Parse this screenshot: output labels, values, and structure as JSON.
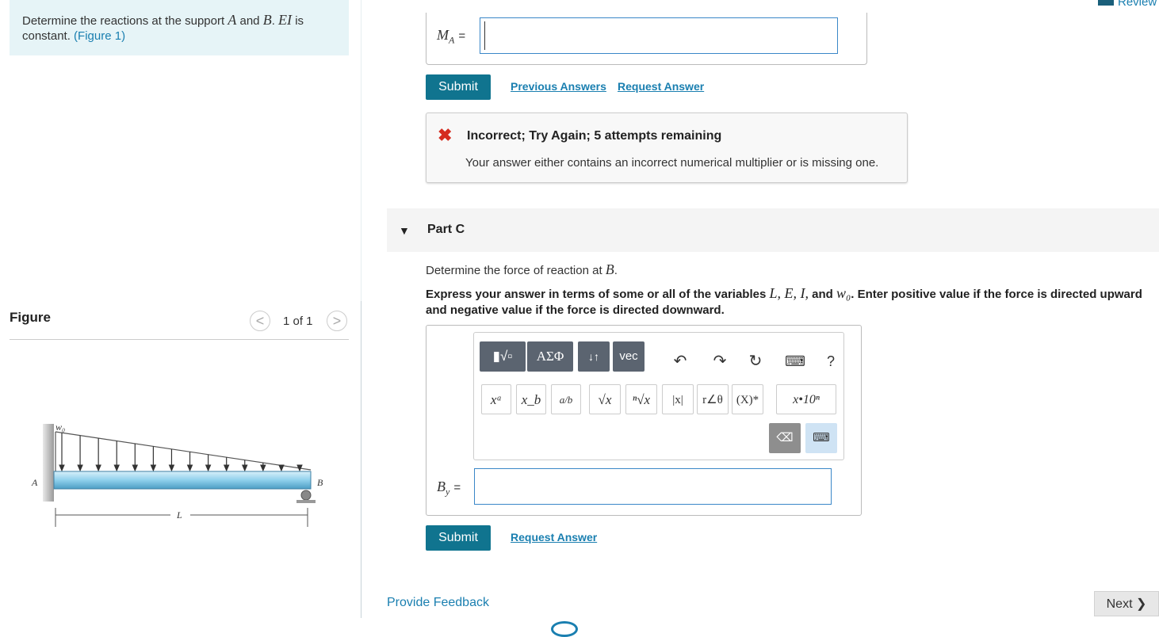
{
  "header": {
    "review_label": "Review"
  },
  "problem": {
    "text_prefix": "Determine the reactions at the support ",
    "A": "A",
    "and": " and ",
    "B": "B",
    "dot": ". ",
    "EI": "EI",
    "text_suffix": " is constant. ",
    "figure_link": "(Figure 1)"
  },
  "figure": {
    "title": "Figure",
    "counter": "1 of 1",
    "prev_glyph": "<",
    "next_glyph": ">",
    "labels": {
      "w0": "w₀",
      "A": "A",
      "B": "B",
      "L": "L"
    }
  },
  "part_b": {
    "label": "M",
    "label_sub": "A",
    "equals": "=",
    "input_value": "",
    "submit_label": "Submit",
    "previous_answers_label": "Previous Answers",
    "request_answer_label": "Request Answer",
    "feedback": {
      "title": "Incorrect; Try Again; 5 attempts remaining",
      "message": "Your answer either contains an incorrect numerical multiplier or is missing one."
    }
  },
  "part_c": {
    "title": "Part C",
    "question_prefix": "Determine the force of reaction at ",
    "question_var": "B",
    "question_suffix": ".",
    "instruction_1": "Express your answer in terms of some or all of the variables ",
    "vars": "L, E, I,",
    "instruction_2": " and ",
    "w0": "w₀",
    "instruction_3": ". Enter positive value if the force is directed upward and negative value if the force is directed downward.",
    "toolbar": {
      "templates": "▮√▫",
      "greek": "ΑΣΦ",
      "arrows": "↓↑",
      "vec": "vec",
      "undo": "↶",
      "redo": "↷",
      "reset": "↻",
      "keyboard": "⌨",
      "help": "?",
      "superscript": "xᵃ",
      "subscript": "x_b",
      "fraction": "a/b",
      "sqrt": "√x",
      "nroot": "ⁿ√x",
      "abs": "|x|",
      "polar": "r∠θ",
      "conj": "(X)*",
      "sci": "x•10ⁿ",
      "backspace": "⌫",
      "keypad": "⌨"
    },
    "label": "B",
    "label_sub": "y",
    "equals": "=",
    "input_value": "",
    "submit_label": "Submit",
    "request_answer_label": "Request Answer"
  },
  "footer": {
    "provide_feedback_label": "Provide Feedback",
    "next_label": "Next ❯"
  },
  "colors": {
    "accent": "#10748f",
    "link": "#1a7fb0",
    "error": "#d52b1e",
    "beam": "#8fd0ec"
  }
}
